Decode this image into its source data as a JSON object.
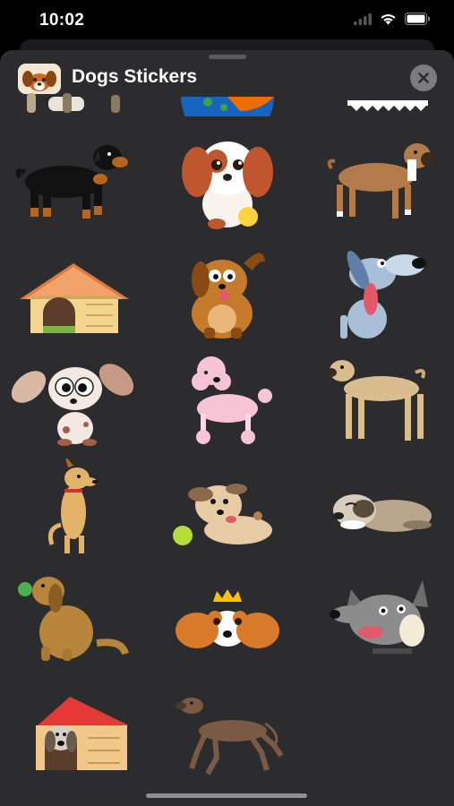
{
  "status_bar": {
    "time": "10:02",
    "icons": [
      "cellular-icon",
      "wifi-icon",
      "battery-icon"
    ]
  },
  "sheet": {
    "title": "Dogs Stickers",
    "close_icon": "close-icon",
    "app_icon": "dog-app-icon"
  },
  "stickers": [
    {
      "name": "partial-dog-sticker"
    },
    {
      "name": "ball-sticker"
    },
    {
      "name": "bone-sticker"
    },
    {
      "name": "rottweiler-sticker"
    },
    {
      "name": "puppy-with-ball-sticker"
    },
    {
      "name": "boxer-dog-sticker"
    },
    {
      "name": "doghouse-sticker"
    },
    {
      "name": "brown-cartoon-dog-sticker"
    },
    {
      "name": "blue-dog-sticker"
    },
    {
      "name": "big-eyed-puppy-sticker"
    },
    {
      "name": "pink-poodle-sticker"
    },
    {
      "name": "tan-dog-sticker"
    },
    {
      "name": "standing-dog-sticker"
    },
    {
      "name": "playful-dog-sticker"
    },
    {
      "name": "sleeping-dog-sticker"
    },
    {
      "name": "golden-retriever-sticker"
    },
    {
      "name": "crowned-spaniel-sticker"
    },
    {
      "name": "wolf-dog-sticker"
    },
    {
      "name": "dog-in-doghouse-sticker"
    },
    {
      "name": "pointer-dog-sticker"
    }
  ],
  "colors": {
    "sheet_bg": "#2c2c2e",
    "close_button_bg": "#7b7b80"
  }
}
